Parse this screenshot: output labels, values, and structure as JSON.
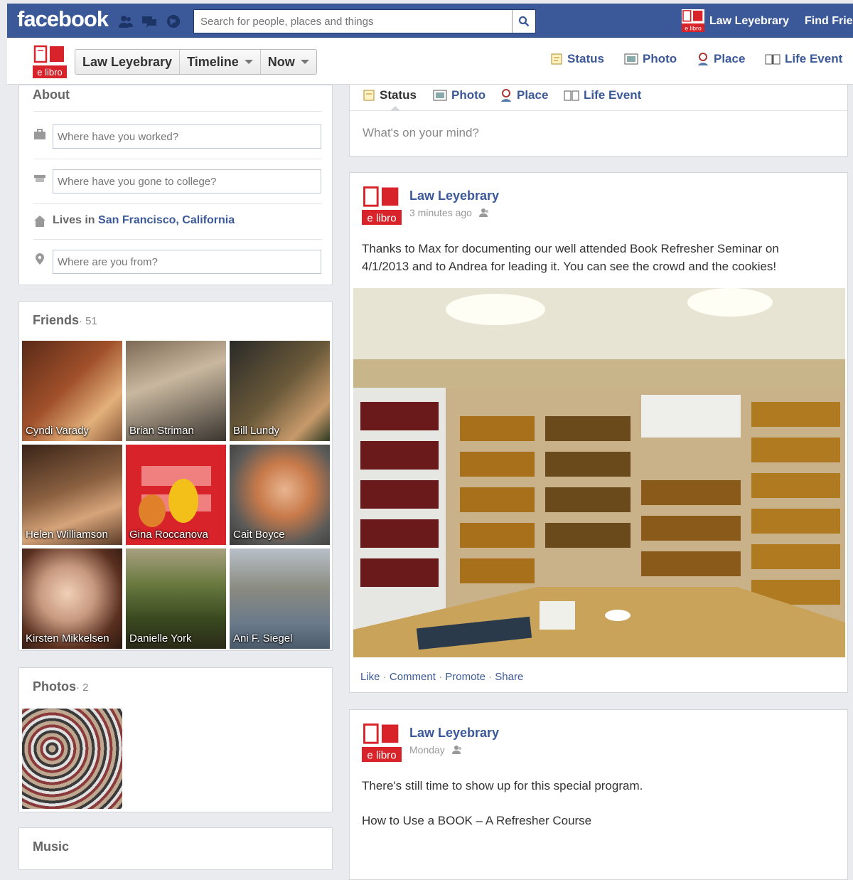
{
  "topbar": {
    "logo": "facebook",
    "jewels": [
      "friends-icon",
      "messages-icon",
      "notifications-icon"
    ],
    "search_placeholder": "Search for people, places and things",
    "profile_name": "Law Leyebrary",
    "find_friends": "Find Frie"
  },
  "subbar": {
    "crumbs": [
      "Law Leyebrary",
      "Timeline",
      "Now"
    ],
    "publisher": {
      "status": "Status",
      "photo": "Photo",
      "place": "Place",
      "life_event": "Life Event"
    }
  },
  "logo_text": "e libro",
  "about": {
    "title": "About",
    "work_placeholder": "Where have you worked?",
    "college_placeholder": "Where have you gone to college?",
    "lives_prefix": "Lives in",
    "lives_city": "San Francisco, California",
    "from_placeholder": "Where are you from?"
  },
  "friends": {
    "title": "Friends",
    "count": "· 51",
    "items": [
      {
        "name": "Cyndi Varady"
      },
      {
        "name": "Brian Striman"
      },
      {
        "name": "Bill Lundy"
      },
      {
        "name": "Helen Williamson"
      },
      {
        "name": "Gina Roccanova"
      },
      {
        "name": "Cait Boyce"
      },
      {
        "name": "Kirsten Mikkelsen"
      },
      {
        "name": "Danielle York"
      },
      {
        "name": "Ani F. Siegel"
      }
    ]
  },
  "photos": {
    "title": "Photos",
    "count": "· 2"
  },
  "music": {
    "title": "Music"
  },
  "composer": {
    "tabs": {
      "status": "Status",
      "photo": "Photo",
      "place": "Place",
      "life_event": "Life Event"
    },
    "placeholder": "What's on your mind?"
  },
  "posts": [
    {
      "author": "Law Leyebrary",
      "time": "3 minutes ago",
      "text": "Thanks to Max for documenting our well attended Book Refresher Seminar on 4/1/2013 and to Andrea for leading it. You can see the crowd and the cookies!",
      "actions": {
        "like": "Like",
        "comment": "Comment",
        "promote": "Promote",
        "share": "Share"
      }
    },
    {
      "author": "Law Leyebrary",
      "time": "Monday",
      "text": "There's still time to show up for this special program.",
      "text2": "How to Use a BOOK – A Refresher Course"
    }
  ],
  "colors": {
    "brand": "#3b5998",
    "logo_red": "#d8232a"
  }
}
